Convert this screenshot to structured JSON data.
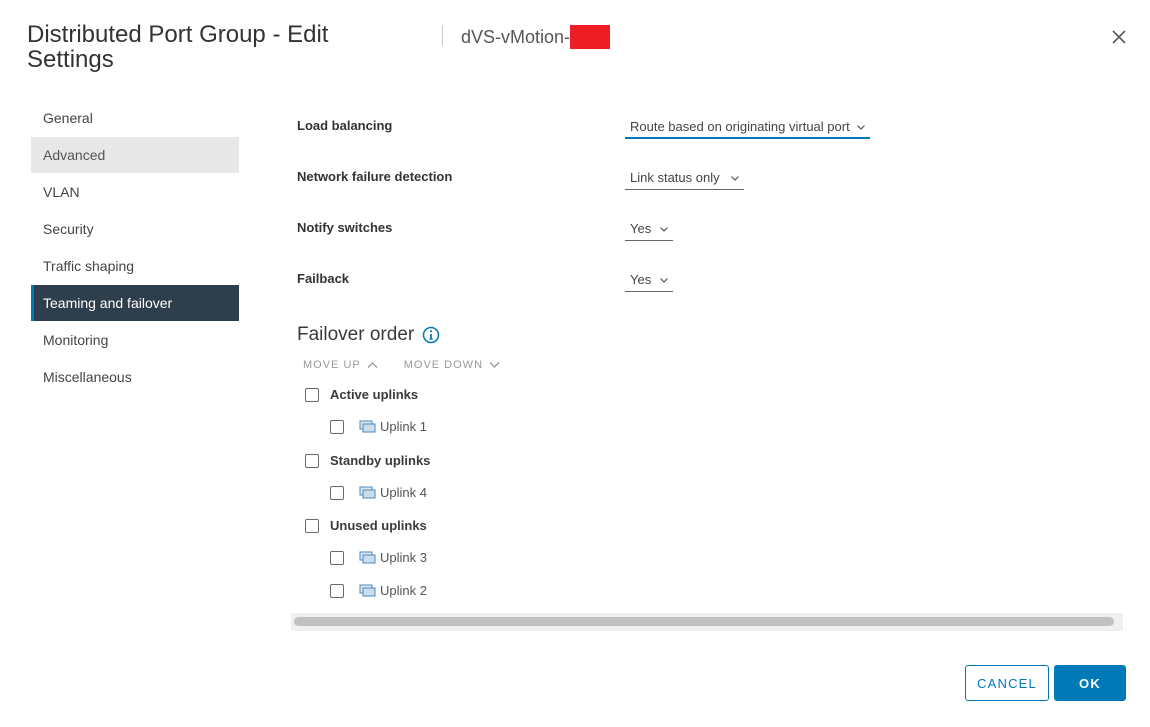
{
  "header": {
    "title": "Distributed Port Group - Edit Settings",
    "subtitle": "dVS-vMotion-",
    "redaction_color": "#ee1c25"
  },
  "sidebar": {
    "items": [
      {
        "label": "General",
        "state": "normal"
      },
      {
        "label": "Advanced",
        "state": "hover"
      },
      {
        "label": "VLAN",
        "state": "normal"
      },
      {
        "label": "Security",
        "state": "normal"
      },
      {
        "label": "Traffic shaping",
        "state": "normal"
      },
      {
        "label": "Teaming and failover",
        "state": "active"
      },
      {
        "label": "Monitoring",
        "state": "normal"
      },
      {
        "label": "Miscellaneous",
        "state": "normal"
      }
    ]
  },
  "form": {
    "load_balancing": {
      "label": "Load balancing",
      "value": "Route based on originating virtual port"
    },
    "network_failure_detection": {
      "label": "Network failure detection",
      "value": "Link status only"
    },
    "notify_switches": {
      "label": "Notify switches",
      "value": "Yes"
    },
    "failback": {
      "label": "Failback",
      "value": "Yes"
    }
  },
  "failover": {
    "title": "Failover order",
    "move_up": "MOVE UP",
    "move_down": "MOVE DOWN",
    "groups": [
      {
        "label": "Active uplinks",
        "uplinks": [
          "Uplink 1"
        ]
      },
      {
        "label": "Standby uplinks",
        "uplinks": [
          "Uplink 4"
        ]
      },
      {
        "label": "Unused uplinks",
        "uplinks": [
          "Uplink 3",
          "Uplink 2"
        ]
      }
    ]
  },
  "footer": {
    "cancel": "CANCEL",
    "ok": "OK"
  },
  "colors": {
    "accent": "#0079b8",
    "nav_active_bg": "#2f3e4c",
    "nav_hover_bg": "#e8e8e8"
  },
  "icons": {
    "close": "close-icon",
    "info": "info-icon",
    "chevron": "chevron-down-icon",
    "uplink": "uplink-icon"
  }
}
